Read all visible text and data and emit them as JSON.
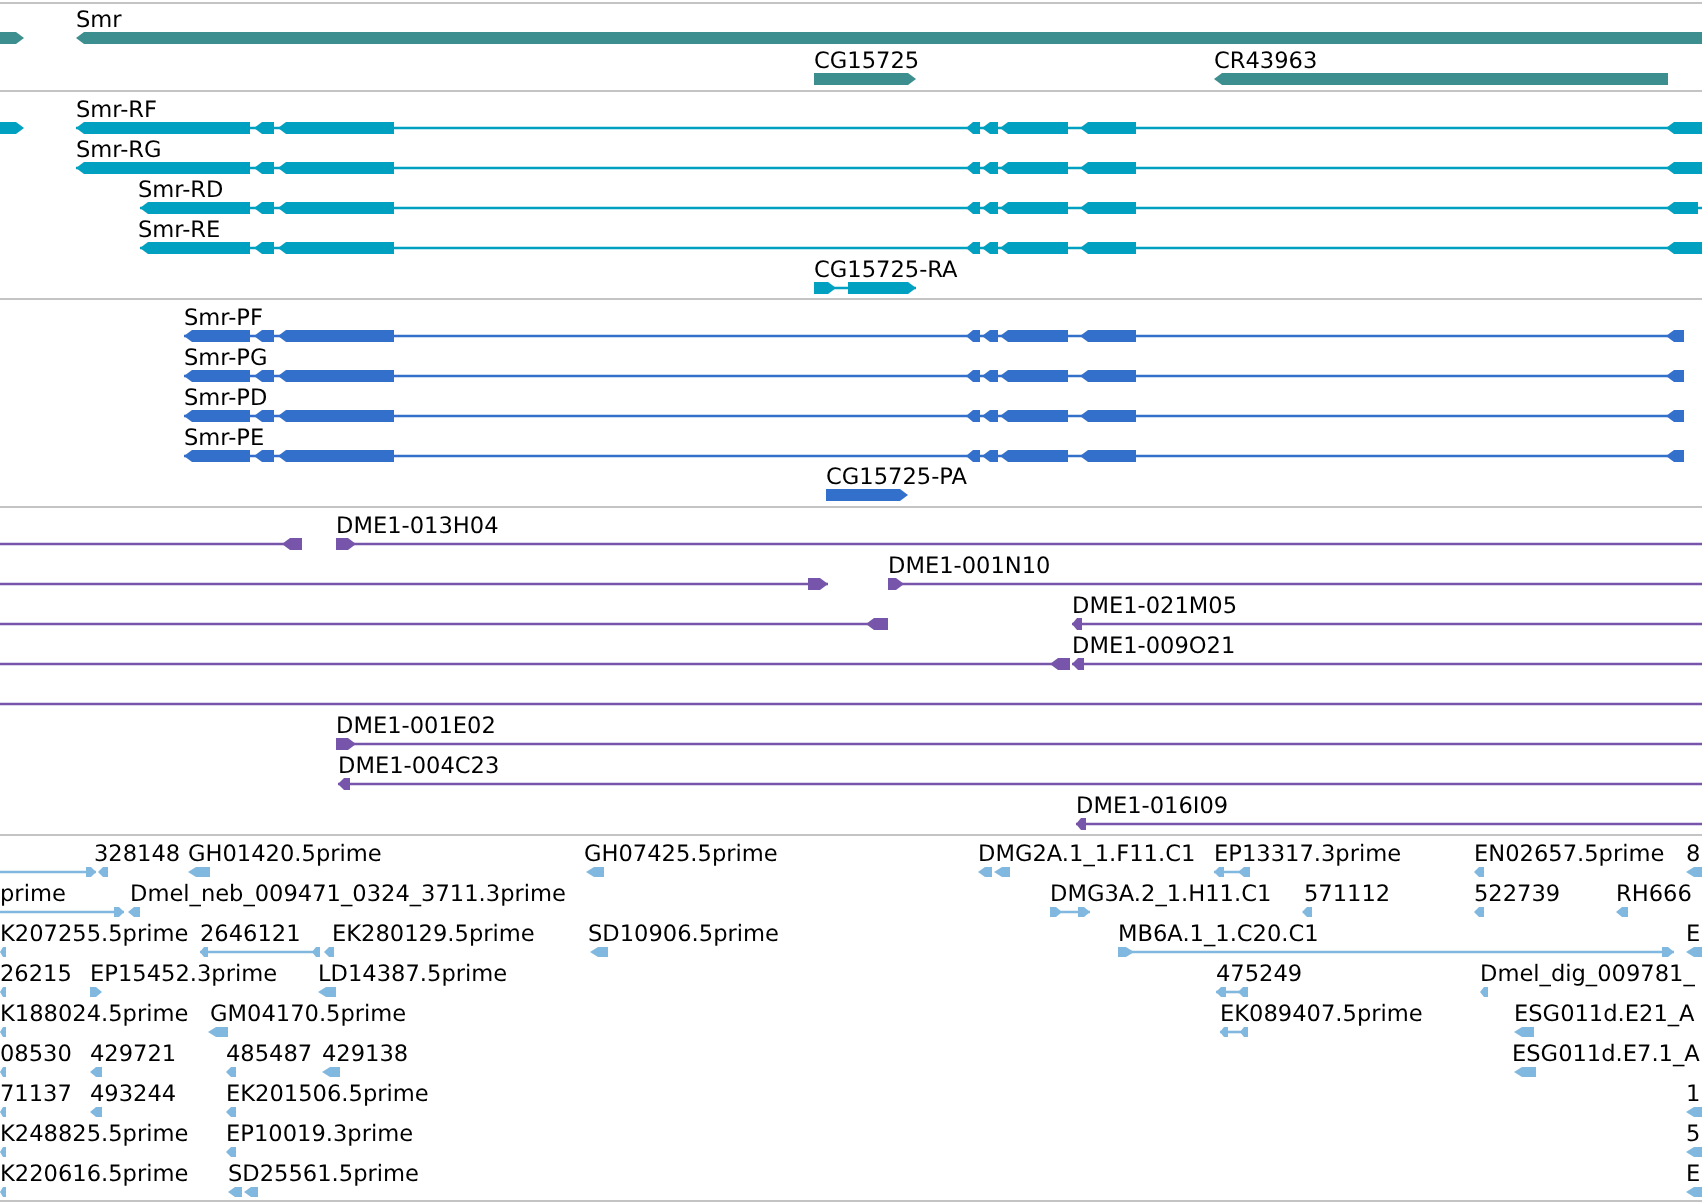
{
  "tracks": [
    {
      "kind": "gene",
      "features": [
        {
          "forward": true
        },
        {
          "name": "Smr",
          "forward": false
        },
        {
          "name": "CG15725",
          "forward": true
        },
        {
          "name": "CR43963",
          "forward": false
        }
      ]
    },
    {
      "kind": "transcript",
      "features": [
        {
          "forward": true
        },
        {
          "name": "Smr-RF",
          "forward": false
        },
        {
          "name": "Smr-RG",
          "forward": false
        },
        {
          "name": "Smr-RD",
          "forward": false
        },
        {
          "name": "Smr-RE",
          "forward": false
        },
        {
          "name": "CG15725-RA",
          "forward": true
        }
      ]
    },
    {
      "kind": "protein",
      "features": [
        {
          "name": "Smr-PF",
          "forward": false
        },
        {
          "name": "Smr-PG",
          "forward": false
        },
        {
          "name": "Smr-PD",
          "forward": false
        },
        {
          "name": "Smr-PE",
          "forward": false
        },
        {
          "name": "CG15725-PA",
          "forward": true
        }
      ]
    },
    {
      "kind": "clone",
      "features": [
        {
          "kind": "clone-end",
          "forward": false
        },
        {
          "kind": "clone-end",
          "name": "DME1-013H04",
          "forward": true
        },
        {
          "kind": "clone-end",
          "forward": true
        },
        {
          "kind": "clone-end",
          "name": "DME1-001N10",
          "forward": true
        },
        {
          "kind": "clone-end",
          "forward": false
        },
        {
          "kind": "clone-end",
          "name": "DME1-021M05",
          "forward": false
        },
        {
          "kind": "clone-end",
          "forward": false
        },
        {
          "kind": "clone-end",
          "name": "DME1-009O21",
          "forward": false
        },
        {
          "kind": "clone-span"
        },
        {
          "kind": "clone-end",
          "name": "DME1-001E02",
          "forward": true
        },
        {
          "kind": "clone-end",
          "name": "DME1-004C23",
          "forward": false
        },
        {
          "kind": "clone-end",
          "name": "DME1-016I09",
          "forward": false
        }
      ]
    },
    {
      "kind": "est",
      "features": [
        {
          "forward": true
        },
        {
          "name": "328148",
          "forward": false
        },
        {
          "name": "GH01420.5prime",
          "forward": false
        },
        {
          "name": "GH07425.5prime",
          "forward": false
        },
        {
          "name": "DMG2A.1_1.F11.C1",
          "forward": false
        },
        {
          "name": "EP13317.3prime",
          "forward": false
        },
        {
          "name": "EN02657.5prime",
          "forward": false
        },
        {
          "name": "8",
          "forward": false
        },
        {
          "name": "prime",
          "forward": true
        },
        {
          "name": "Dmel_neb_009471_0324_3711.3prime",
          "forward": false
        },
        {
          "name": "DMG3A.2_1.H11.C1",
          "forward": true
        },
        {
          "name": "571112",
          "forward": false
        },
        {
          "name": "522739",
          "forward": false
        },
        {
          "name": "RH666",
          "forward": false
        },
        {
          "name": "K207255.5prime",
          "forward": false
        },
        {
          "name": "2646121",
          "forward": false
        },
        {
          "name": "EK280129.5prime",
          "forward": false
        },
        {
          "name": "SD10906.5prime",
          "forward": false
        },
        {
          "name": "MB6A.1_1.C20.C1",
          "forward": true
        },
        {
          "name": "E",
          "forward": false
        },
        {
          "name": "26215",
          "forward": false
        },
        {
          "name": "EP15452.3prime",
          "forward": true
        },
        {
          "name": "LD14387.5prime",
          "forward": false
        },
        {
          "name": "475249",
          "forward": false
        },
        {
          "name": "Dmel_dig_009781_",
          "forward": false
        },
        {
          "name": "K188024.5prime",
          "forward": false
        },
        {
          "name": "GM04170.5prime",
          "forward": false
        },
        {
          "name": "EK089407.5prime",
          "forward": false
        },
        {
          "name": "ESG011d.E21_A",
          "forward": false
        },
        {
          "name": "08530",
          "forward": false
        },
        {
          "name": "429721",
          "forward": false
        },
        {
          "name": "485487",
          "forward": false
        },
        {
          "name": "429138",
          "forward": false
        },
        {
          "name": "ESG011d.E7.1_A",
          "forward": false
        },
        {
          "name": "71137",
          "forward": false
        },
        {
          "name": "493244",
          "forward": false
        },
        {
          "name": "EK201506.5prime",
          "forward": false
        },
        {
          "name": "1",
          "forward": false
        },
        {
          "name": "K248825.5prime",
          "forward": false
        },
        {
          "name": "EP10019.3prime",
          "forward": false
        },
        {
          "name": "5",
          "forward": false
        },
        {
          "name": "K220616.5prime",
          "forward": false
        },
        {
          "name": "SD25561.5prime",
          "forward": false
        },
        {
          "name": "E",
          "forward": false
        }
      ]
    }
  ]
}
